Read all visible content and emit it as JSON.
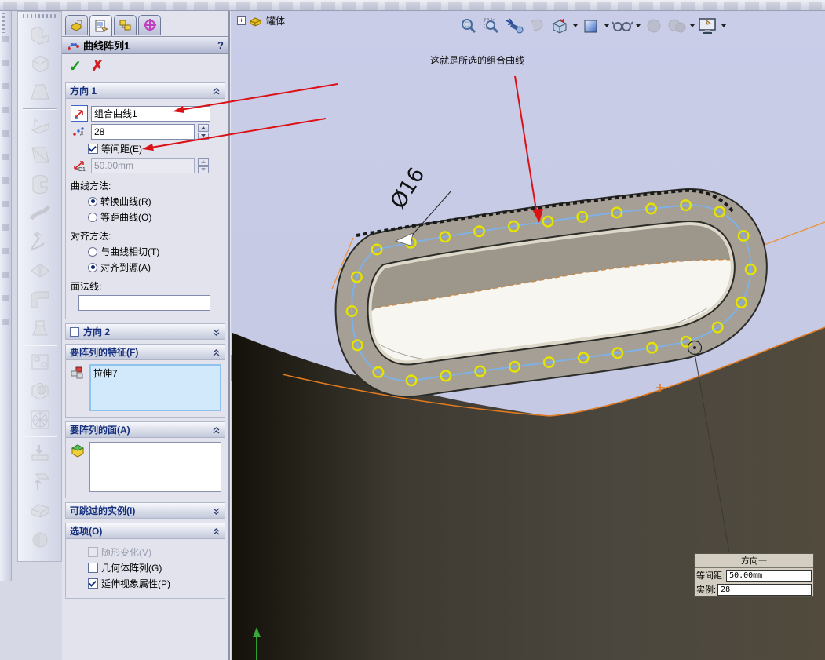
{
  "property_manager": {
    "title": "曲线阵列1",
    "help_label": "?",
    "direction1": {
      "header": "方向 1",
      "curve_field_value": "组合曲线1",
      "instances_value": "28",
      "equal_spacing_label": "等间距(E)",
      "spacing_value": "50.00mm",
      "d1_label": "D1",
      "curve_method_label": "曲线方法:",
      "transform_curve_label": "转换曲线(R)",
      "offset_curve_label": "等距曲线(O)",
      "alignment_method_label": "对齐方法:",
      "tangent_to_curve_label": "与曲线相切(T)",
      "align_to_seed_label": "对齐到源(A)",
      "face_normal_label": "面法线:",
      "face_normal_value": ""
    },
    "direction2": {
      "header": "方向 2"
    },
    "features_to_pattern": {
      "header": "要阵列的特征(F)",
      "items": [
        "拉伸7"
      ]
    },
    "faces_to_pattern": {
      "header": "要阵列的面(A)"
    },
    "instances_to_skip": {
      "header": "可跳过的实例(I)"
    },
    "options": {
      "header": "选项(O)",
      "vary_sketch_label": "随形变化(V)",
      "geometry_pattern_label": "几何体阵列(G)",
      "propagate_visual_label": "延伸视象属性(P)"
    }
  },
  "viewport": {
    "tree_node_label": "罐体",
    "tree_expander": "+",
    "annotation_text": "这就是所选的组合曲线",
    "dimension_label": "Ø16",
    "pattern": {
      "instances": 28
    },
    "callout": {
      "title": "方向一",
      "spacing_label": "等间距:",
      "spacing_value": "50.00mm",
      "instances_label": "实例:",
      "instances_value": "28"
    }
  },
  "colors": {
    "viewport_background": "#c6cbe5",
    "composite_curve_blue": "#7fb0e6",
    "pattern_preview_yellow": "#e4e400",
    "selection_orange": "#e8953c",
    "annotation_red": "#dd1016",
    "flange_gray": "#a69f95",
    "dark_body": "#45413a",
    "listbox_selected_blue": "#d2e9fb"
  }
}
